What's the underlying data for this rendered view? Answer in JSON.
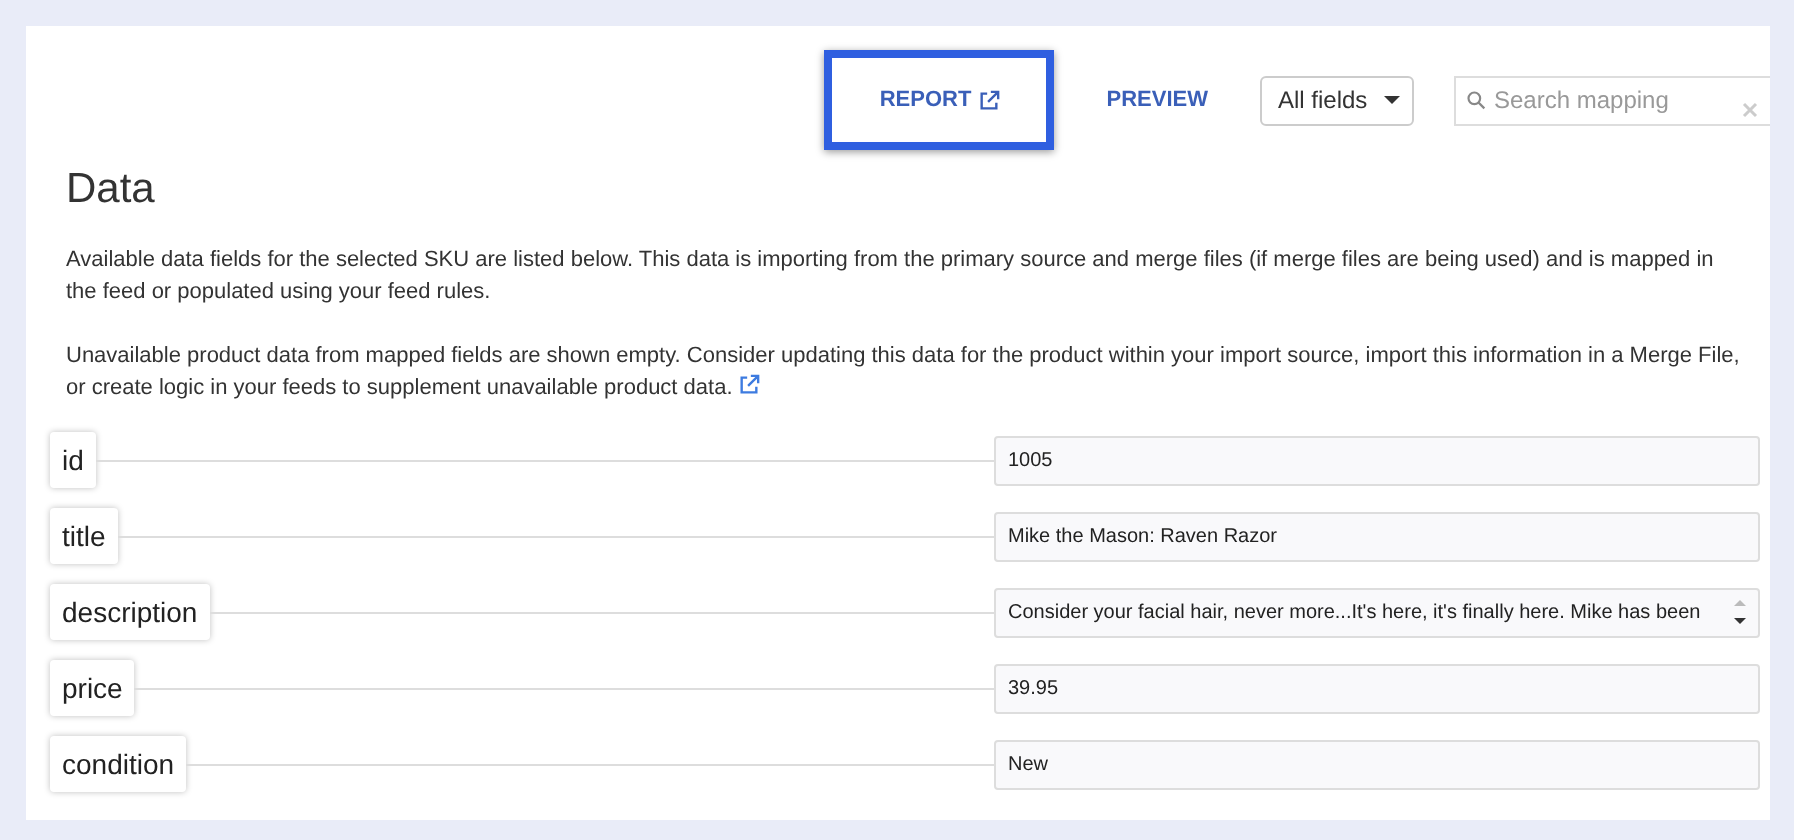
{
  "toolbar": {
    "links": [
      {
        "label": "REPORT",
        "external": true,
        "highlighted": true
      },
      {
        "label": "PREVIEW",
        "external": false,
        "highlighted": false
      }
    ],
    "filter": {
      "value": "All fields"
    },
    "search": {
      "placeholder": "Search mapping"
    }
  },
  "section": {
    "title": "Data",
    "paragraphs": [
      {
        "text": "Available data fields for the selected SKU are listed below. This data is importing from the primary source and merge files (if merge files are being used) and is mapped in the feed or populated using your feed rules.",
        "external": false
      },
      {
        "text": "Unavailable product data from mapped fields are shown empty. Consider updating this data for the product within your import source, import this information in a Merge File, or create logic in your feeds to supplement unavailable product data.",
        "external": true
      }
    ]
  },
  "fields": [
    {
      "name": "id",
      "value": "1005",
      "kind": "input"
    },
    {
      "name": "title",
      "value": "Mike the Mason: Raven Razor",
      "kind": "input"
    },
    {
      "name": "description",
      "value": "Consider your facial hair, never more...It's here, it's finally here. Mike has been",
      "kind": "textarea"
    },
    {
      "name": "price",
      "value": "39.95",
      "kind": "input"
    },
    {
      "name": "condition",
      "value": "New",
      "kind": "input"
    }
  ]
}
